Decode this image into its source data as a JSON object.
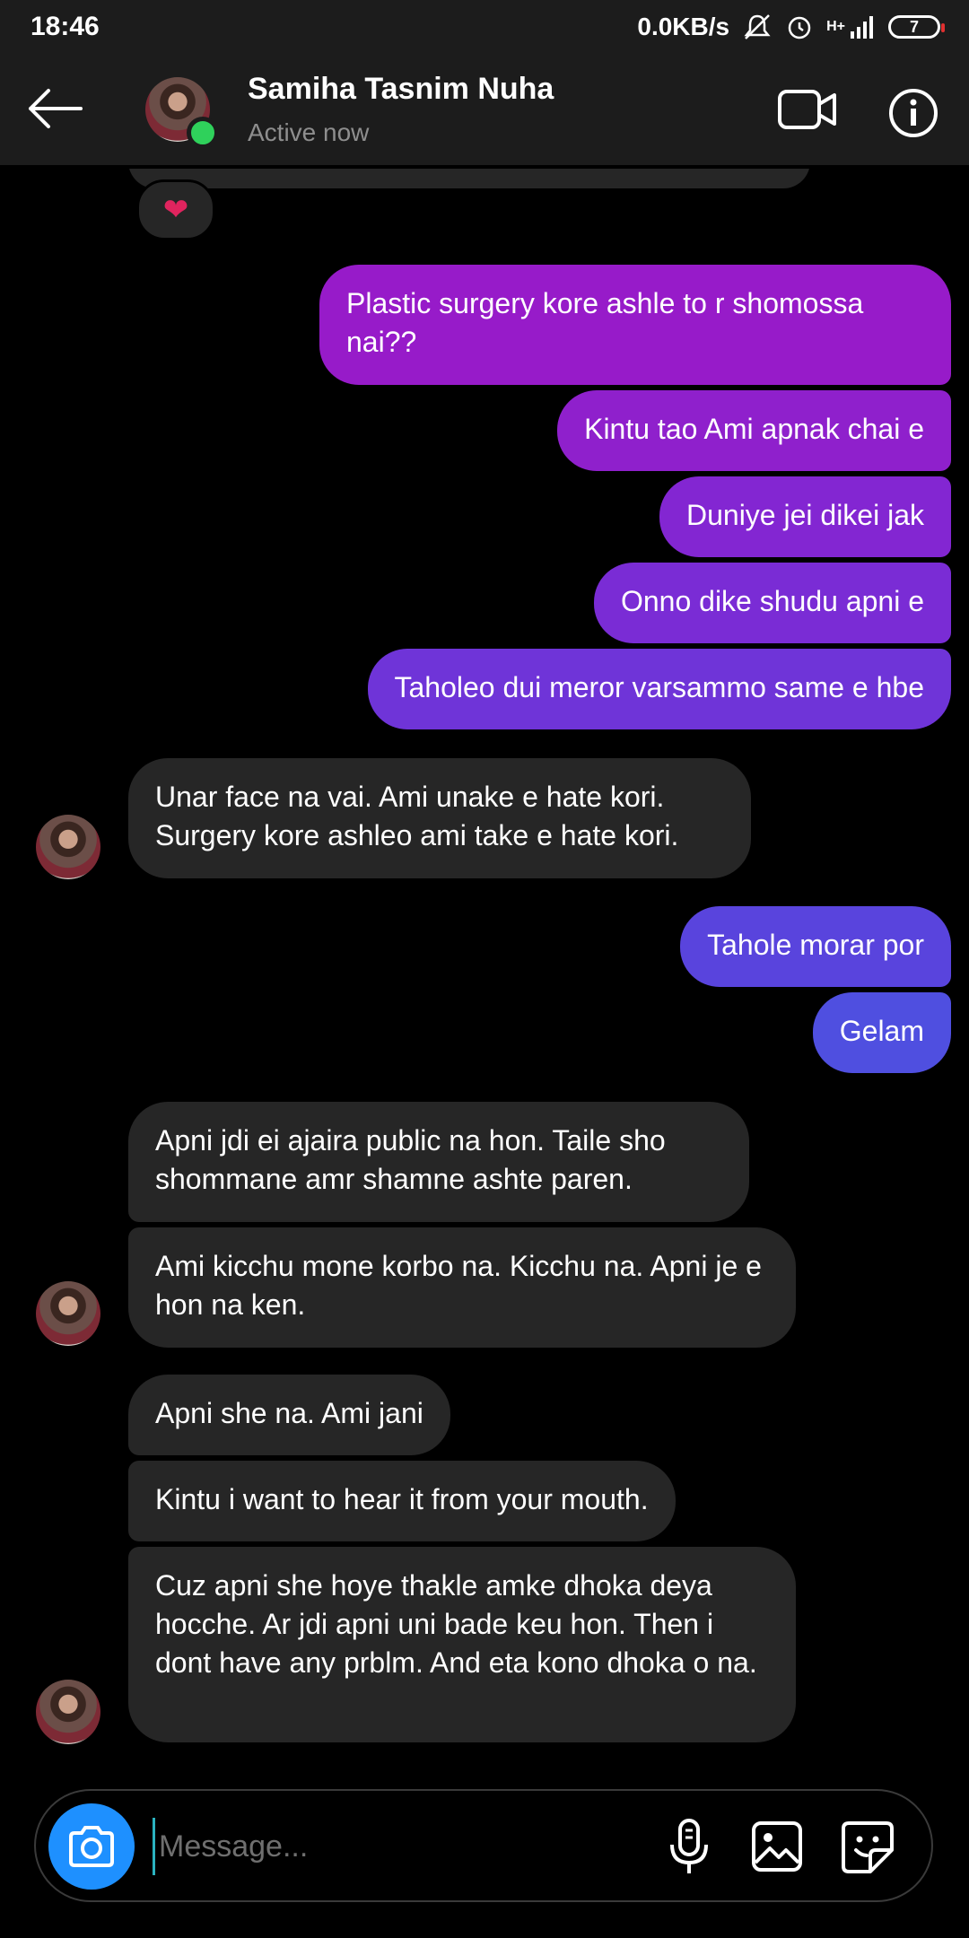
{
  "status_bar": {
    "time": "18:46",
    "network_speed": "0.0KB/s",
    "network_type": "H+",
    "battery": "7",
    "icons": [
      "mute-icon",
      "alarm-icon",
      "signal-icon",
      "battery-icon"
    ]
  },
  "header": {
    "name": "Samiha Tasnim Nuha",
    "status": "Active now",
    "online_color": "#2fd15b"
  },
  "reaction": "❤",
  "messages": {
    "m1": "Plastic surgery kore ashle to r shomossa nai??",
    "m2": "Kintu tao Ami apnak chai e",
    "m3": "Duniye jei dikei jak",
    "m4": "Onno dike shudu apni e",
    "m5": "Taholeo dui meror varsammo same e hbe",
    "m6": "Unar face na vai. Ami unake e hate kori. Surgery kore ashleo ami take e hate kori.",
    "m7": "Tahole morar por",
    "m8": "Gelam",
    "m9": "Apni jdi ei ajaira public na hon. Taile sho shommane amr shamne ashte paren.",
    "m10": "Ami kicchu mone korbo na. Kicchu na. Apni je e hon na ken.",
    "m11": "Apni she na. Ami jani",
    "m12": "Kintu i want to hear it from your mouth.",
    "m13": "Cuz apni she hoye thakle amke dhoka deya hocche. Ar jdi apni uni bade keu hon. Then i dont have any prblm. And eta kono dhoka o na."
  },
  "colors": {
    "outgoing_gradient": [
      "#9a1ccc",
      "#4f4fe0"
    ],
    "incoming_bg": "#262626",
    "camera_button": "#1e90ff"
  },
  "composer": {
    "placeholder": "Message..."
  }
}
